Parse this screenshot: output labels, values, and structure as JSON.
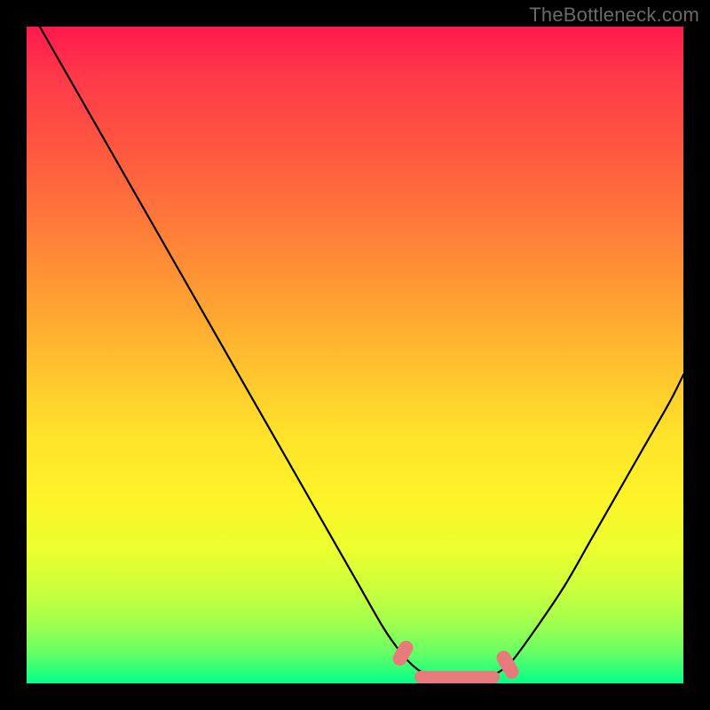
{
  "watermark": "TheBottleneck.com",
  "colors": {
    "pink_marker": "#e77a7a",
    "curve": "#000000"
  },
  "chart_data": {
    "type": "line",
    "title": "",
    "xlabel": "",
    "ylabel": "",
    "xlim": [
      0,
      100
    ],
    "ylim": [
      0,
      100
    ],
    "grid": false,
    "legend": false,
    "series": [
      {
        "name": "bottleneck-curve",
        "x": [
          2,
          6,
          10,
          14,
          18,
          22,
          26,
          30,
          34,
          38,
          42,
          46,
          50,
          54,
          56,
          58,
          60,
          62,
          65,
          68,
          70,
          72,
          74,
          78,
          82,
          86,
          90,
          94,
          98,
          100
        ],
        "values": [
          100,
          93,
          86,
          79,
          72,
          65,
          58,
          51,
          44,
          37,
          30,
          23,
          16,
          9,
          6,
          3.5,
          1.8,
          0.8,
          0.3,
          0.3,
          0.8,
          1.8,
          3.5,
          9,
          15,
          22,
          29,
          36,
          43,
          47
        ]
      }
    ],
    "annotations": {
      "highlight_range_x": [
        57,
        74
      ],
      "highlight_color": "#e77a7a"
    }
  }
}
